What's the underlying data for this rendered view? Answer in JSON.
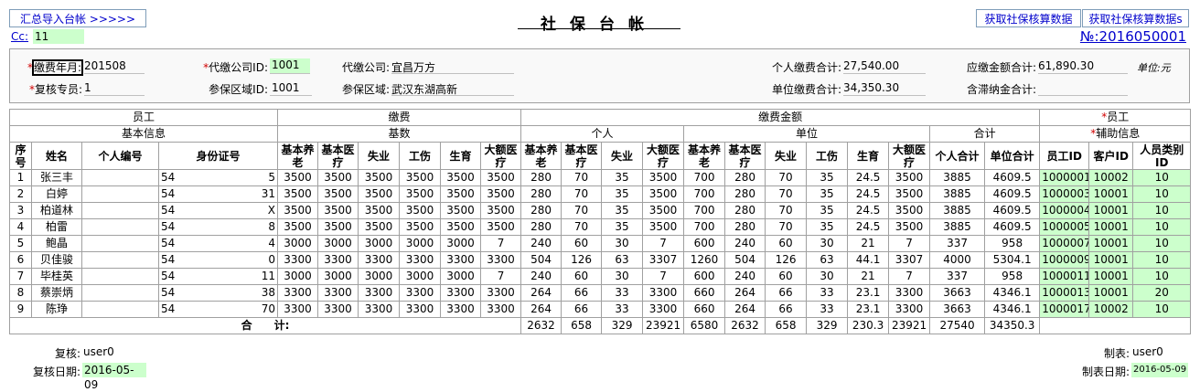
{
  "toolbar": {
    "import_label": "汇总导入台帐 >>>>>",
    "fetch_label": "获取社保核算数据",
    "fetch_s_label": "获取社保核算数据s"
  },
  "page": {
    "title": "社保台帐",
    "cc_label": "Cc:",
    "cc_value": "11",
    "doc_no": "№:2016050001"
  },
  "header": {
    "pay_month_label": "缴费年月:",
    "pay_month_value": "201508",
    "reviewer_label": "复核专员:",
    "reviewer_value": "1",
    "agent_id_label": "代缴公司ID:",
    "agent_id_value": "1001",
    "area_id_label": "参保区域ID:",
    "area_id_value": "1001",
    "agent_company_label": "代缴公司:",
    "agent_company_value": "宜昌万方",
    "area_label": "参保区域:",
    "area_value": "武汉东湖高新",
    "personal_total_label": "个人缴费合计:",
    "personal_total_value": "27,540.00",
    "company_total_label": "单位缴费合计:",
    "company_total_value": "34,350.30",
    "due_total_label": "应缴金额合计:",
    "due_total_value": "61,890.30",
    "late_fee_label": "含滞纳金合计:",
    "late_fee_value": "",
    "unit_note": "单位:元"
  },
  "table": {
    "group_headers": [
      "员工",
      "缴费",
      "缴费金额",
      "员工"
    ],
    "sub_headers": [
      "基本信息",
      "基数",
      "个人",
      "单位",
      "合计",
      "辅助信息"
    ],
    "columns": [
      "序号",
      "姓名",
      "个人编号",
      "身份证号",
      "基本养老",
      "基本医疗",
      "失业",
      "工伤",
      "生育",
      "大额医疗",
      "基本养老",
      "基本医疗",
      "失业",
      "大额医疗",
      "基本养老",
      "基本医疗",
      "失业",
      "工伤",
      "生育",
      "大额医疗",
      "个人合计",
      "单位合计",
      "员工ID",
      "客户ID",
      "人员类别ID"
    ],
    "rows": [
      [
        "1",
        "张三丰",
        "",
        "54",
        "5",
        "3500",
        "3500",
        "3500",
        "3500",
        "3500",
        "3500",
        "280",
        "70",
        "35",
        "3500",
        "700",
        "280",
        "70",
        "35",
        "24.5",
        "3500",
        "3885",
        "4609.5",
        "1000001",
        "10002",
        "10"
      ],
      [
        "2",
        "白婷",
        "",
        "54",
        "31",
        "3500",
        "3500",
        "3500",
        "3500",
        "3500",
        "3500",
        "280",
        "70",
        "35",
        "3500",
        "700",
        "280",
        "70",
        "35",
        "24.5",
        "3500",
        "3885",
        "4609.5",
        "1000003",
        "10001",
        "10"
      ],
      [
        "3",
        "柏道林",
        "",
        "54",
        "X",
        "3500",
        "3500",
        "3500",
        "3500",
        "3500",
        "3500",
        "280",
        "70",
        "35",
        "3500",
        "700",
        "280",
        "70",
        "35",
        "24.5",
        "3500",
        "3885",
        "4609.5",
        "1000004",
        "10001",
        "10"
      ],
      [
        "4",
        "柏雷",
        "",
        "54",
        "8",
        "3500",
        "3500",
        "3500",
        "3500",
        "3500",
        "3500",
        "280",
        "70",
        "35",
        "3500",
        "700",
        "280",
        "70",
        "35",
        "24.5",
        "3500",
        "3885",
        "4609.5",
        "1000005",
        "10001",
        "10"
      ],
      [
        "5",
        "鲍晶",
        "",
        "54",
        "4",
        "3000",
        "3000",
        "3000",
        "3000",
        "3000",
        "7",
        "240",
        "60",
        "30",
        "7",
        "600",
        "240",
        "60",
        "30",
        "21",
        "7",
        "337",
        "958",
        "1000007",
        "10001",
        "10"
      ],
      [
        "6",
        "贝佳骏",
        "",
        "54",
        "0",
        "3300",
        "3300",
        "3300",
        "3300",
        "3300",
        "3300",
        "504",
        "126",
        "63",
        "3307",
        "1260",
        "504",
        "126",
        "63",
        "44.1",
        "3307",
        "4000",
        "5304.1",
        "1000009",
        "10001",
        "10"
      ],
      [
        "7",
        "毕桂英",
        "",
        "54",
        "11",
        "3000",
        "3000",
        "3000",
        "3000",
        "3000",
        "7",
        "240",
        "60",
        "30",
        "7",
        "600",
        "240",
        "60",
        "30",
        "21",
        "7",
        "337",
        "958",
        "1000011",
        "10001",
        "10"
      ],
      [
        "8",
        "蔡崇炳",
        "",
        "54",
        "38",
        "3300",
        "3300",
        "3300",
        "3300",
        "3300",
        "3300",
        "264",
        "66",
        "33",
        "3300",
        "660",
        "264",
        "66",
        "33",
        "23.1",
        "3300",
        "3663",
        "4346.1",
        "1000013",
        "10001",
        "20"
      ],
      [
        "9",
        "陈琤",
        "",
        "54",
        "70",
        "3300",
        "3300",
        "3300",
        "3300",
        "3300",
        "3300",
        "264",
        "66",
        "33",
        "3300",
        "660",
        "264",
        "66",
        "33",
        "23.1",
        "3300",
        "3663",
        "4346.1",
        "1000017",
        "10002",
        "10"
      ]
    ],
    "total_label": "合　　计:",
    "totals": [
      "2632",
      "658",
      "329",
      "23921",
      "6580",
      "2632",
      "658",
      "329",
      "230.3",
      "23921",
      "27540",
      "34350.3"
    ]
  },
  "footer": {
    "review_label": "复核:",
    "review_value": "user0",
    "review_date_label": "复核日期:",
    "review_date_value": "2016-05-09",
    "maker_label": "制表:",
    "maker_value": "user0",
    "make_date_label": "制表日期:",
    "make_date_value": "2016-05-09"
  },
  "colors": {
    "highlight": "#ccffcc",
    "required": "#d00000",
    "link": "#0000cc"
  }
}
